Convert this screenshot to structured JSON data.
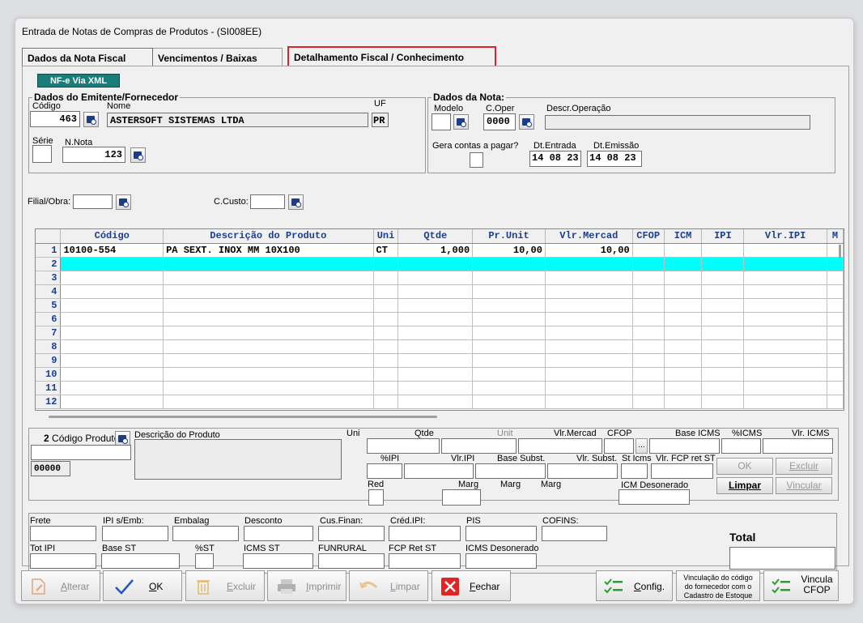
{
  "window": {
    "title": "Entrada de Notas de Compras de Produtos  - (SI008EE)"
  },
  "tabs": [
    {
      "label": "Dados da Nota Fiscal"
    },
    {
      "label": "Vencimentos / Baixas"
    },
    {
      "label": "Detalhamento Fiscal / Conhecimento"
    }
  ],
  "nfe_button": {
    "label": "NF-e Via XML"
  },
  "emitente": {
    "legend": "Dados do Emitente/Fornecedor",
    "codigo_label": "Código",
    "codigo_value": "463",
    "nome_label": "Nome",
    "nome_value": "ASTERSOFT SISTEMAS LTDA",
    "uf_label": "UF",
    "uf_value": "PR",
    "serie_label": "Série",
    "serie_value": "",
    "nnota_label": "N.Nota",
    "nnota_value": "123"
  },
  "nota": {
    "legend": "Dados da Nota:",
    "modelo_label": "Modelo",
    "modelo_value": "",
    "coper_label": "C.Oper",
    "coper_value": "0000",
    "descr_label": "Descr.Operação",
    "descr_value": "",
    "gera_label": "Gera contas a pagar?",
    "dtentrada_label": "Dt.Entrada",
    "dtentrada": [
      "14",
      "08",
      "23"
    ],
    "dtemissao_label": "Dt.Emissão",
    "dtemissao": [
      "14",
      "08",
      "23"
    ]
  },
  "filial": {
    "label": "Filial/Obra:",
    "value": ""
  },
  "ccusto": {
    "label": "C.Custo:",
    "value": ""
  },
  "grid": {
    "columns": [
      "Código",
      "Descrição do Produto",
      "Uni",
      "Qtde",
      "Pr.Unit",
      "Vlr.Mercad",
      "CFOP",
      "ICM",
      "IPI",
      "Vlr.IPI",
      "M"
    ],
    "rows": [
      {
        "n": "1",
        "codigo": "10100-554",
        "descricao": "PA SEXT. INOX MM 10X100",
        "uni": "CT",
        "qtde": "1,000",
        "prunit": "10,00",
        "vlrmercad": "10,00"
      },
      {
        "n": "2"
      },
      {
        "n": "3"
      },
      {
        "n": "4"
      },
      {
        "n": "5"
      },
      {
        "n": "6"
      },
      {
        "n": "7"
      },
      {
        "n": "8"
      },
      {
        "n": "9"
      },
      {
        "n": "10"
      },
      {
        "n": "11"
      },
      {
        "n": "12"
      }
    ]
  },
  "item": {
    "row_num": "2",
    "codigo_label": "Código Produto",
    "descricao_label": "Descrição do Produto",
    "code_value": "00000",
    "uni_label": "Uni",
    "qtde_label": "Qtde",
    "unit_label": "Unit",
    "vlrmercad_label": "Vlr.Mercad",
    "cfop_label": "CFOP",
    "baseicms_label": "Base ICMS",
    "picms_label": "%ICMS",
    "vlricms_label": "Vlr. ICMS",
    "pipi_label": "%IPI",
    "vlripi_label": "Vlr.IPI",
    "basesubst_label": "Base Subst.",
    "vlrsubst_label": "Vlr. Subst.",
    "sticms_label": "St Icms",
    "vlrfcp_label": "Vlr. FCP ret ST",
    "red_label": "Red",
    "marg1_label": "Marg",
    "marg2_label": "Marg",
    "marg3_label": "Marg",
    "icmsdeson_label": "ICM Desonerado",
    "ok": "OK",
    "excluir": "Excluir",
    "limpar": "Limpar",
    "vincular": "Vincular",
    "ellipsis": "..."
  },
  "totals": {
    "frete": "Frete",
    "ipiemb": "IPI s/Emb:",
    "embalag": "Embalag",
    "desconto": "Desconto",
    "cusfinan": "Cus.Finan:",
    "credipi": "Créd.IPI:",
    "pis": "PIS",
    "cofins": "COFINS:",
    "totipi": "Tot IPI",
    "basest": "Base ST",
    "pst": "%ST",
    "icmsst": "ICMS ST",
    "funrural": "FUNRURAL",
    "fcpretst": "FCP Ret ST",
    "icmsdeson": "ICMS Desonerado",
    "total": "Total"
  },
  "toolbar": {
    "alterar": "Alterar",
    "ok": "OK",
    "excluir": "Excluir",
    "imprimir": "Imprimir",
    "limpar": "Limpar",
    "fechar": "Fechar",
    "config": "Config.",
    "vinculacao": "Vinculação do código do fornecedor com o Cadastro de Estoque",
    "vincula_cfop": "Vincula CFOP"
  },
  "colors": {
    "highlight_row": "#00ffff",
    "header_text": "#1b3d93",
    "tab_highlight": "#e0202a",
    "nfe_button": "#1b7d7a"
  }
}
